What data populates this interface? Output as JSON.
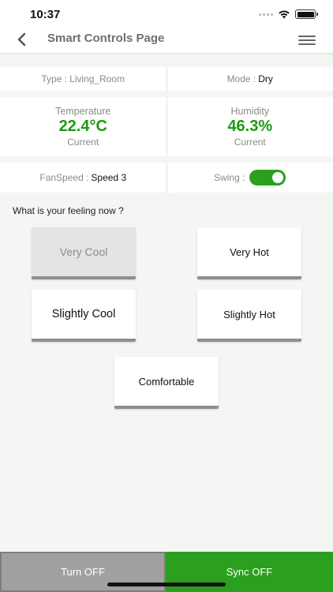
{
  "status_bar": {
    "time": "10:37"
  },
  "nav": {
    "title": "Smart Controls Page",
    "back_icon": "chevron-left-icon",
    "menu_icon": "hamburger-menu-icon"
  },
  "info": {
    "type_label": "Type :",
    "type_value": "Living_Room",
    "mode_label": "Mode :",
    "mode_value": "Dry",
    "temperature": {
      "label": "Temperature",
      "value": "22.4°C",
      "sub": "Current"
    },
    "humidity": {
      "label": "Humidity",
      "value": "46.3%",
      "sub": "Current"
    },
    "fanspeed_label": "FanSpeed :",
    "fanspeed_value": "Speed 3",
    "swing_label": "Swing :",
    "swing_on": true
  },
  "feeling": {
    "question": "What is your feeling now ?",
    "options": [
      {
        "label": "Very Cool",
        "selected": true
      },
      {
        "label": "Very Hot",
        "selected": false
      },
      {
        "label": "Slightly Cool",
        "selected": false
      },
      {
        "label": "Slightly Hot",
        "selected": false
      },
      {
        "label": "Comfortable",
        "selected": false
      }
    ]
  },
  "bottom": {
    "turn_off_label": "Turn OFF",
    "sync_label": "Sync OFF"
  },
  "colors": {
    "accent": "#2aa01e",
    "value_green": "#1e9a12",
    "off_gray": "#a0a0a0",
    "background": "#f4f6f3"
  }
}
